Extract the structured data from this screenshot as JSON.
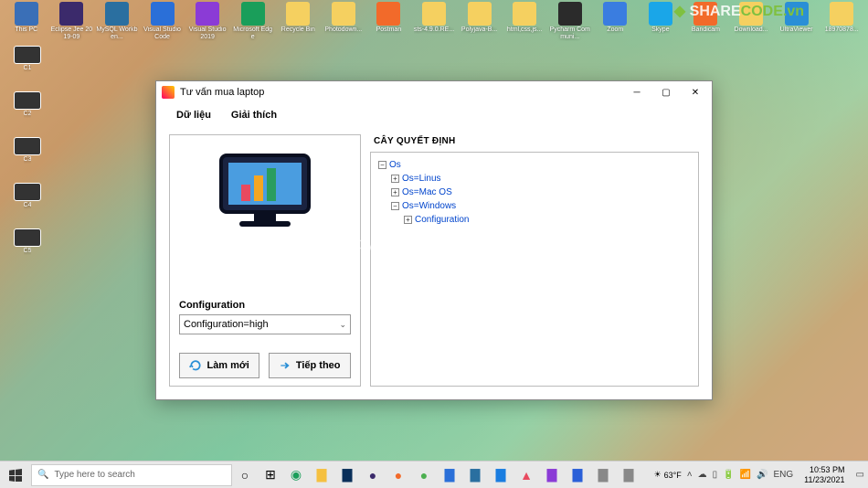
{
  "desktop": {
    "row1": [
      {
        "label": "This PC",
        "color": "#3a6fb7"
      },
      {
        "label": "Eclipse Jee 2019-09",
        "color": "#3b2a6b"
      },
      {
        "label": "MySQL Workben...",
        "color": "#2a6fa0"
      },
      {
        "label": "Visual Studio Code",
        "color": "#2a6fd8"
      },
      {
        "label": "Visual Studio 2019",
        "color": "#8b3bd6"
      },
      {
        "label": "Microsoft Edge",
        "color": "#1a9e5a"
      },
      {
        "label": "Recycle Bin",
        "color": "#f5d060"
      },
      {
        "label": "Photodown...",
        "color": "#f5d060"
      },
      {
        "label": "Postman",
        "color": "#f26a2a"
      },
      {
        "label": "sts-4.9.0.RE...",
        "color": "#f5d060"
      },
      {
        "label": "Polyjava-B...",
        "color": "#f5d060"
      },
      {
        "label": "html,css,js...",
        "color": "#f5d060"
      },
      {
        "label": "Pycharm Communi...",
        "color": "#2b2b2b"
      },
      {
        "label": "Zoom",
        "color": "#3a7de0"
      },
      {
        "label": "Skype",
        "color": "#1aa6e8"
      },
      {
        "label": "Bandicam",
        "color": "#f26a2a"
      },
      {
        "label": "Download...",
        "color": "#f5d060"
      },
      {
        "label": "UltraViewer",
        "color": "#2a8fd6"
      },
      {
        "label": "18970878...",
        "color": "#f5d060"
      }
    ],
    "col": [
      {
        "label": "C1",
        "color": "#333"
      },
      {
        "label": "C2",
        "color": "#333"
      },
      {
        "label": "C3",
        "color": "#333"
      },
      {
        "label": "C4",
        "color": "#333"
      },
      {
        "label": "C5",
        "color": "#333"
      }
    ]
  },
  "app": {
    "title": "Tư vấn mua laptop",
    "menu": {
      "data": "Dữ liệu",
      "explain": "Giải thích"
    },
    "left": {
      "cfg_label": "Configuration",
      "dropdown_value": "Configuration=high",
      "btn_refresh": "Làm mới",
      "btn_next": "Tiếp theo"
    },
    "right": {
      "header": "CÂY QUYẾT ĐỊNH",
      "tree": {
        "root": "Os",
        "children": [
          {
            "label": "Os=Linus"
          },
          {
            "label": "Os=Mac OS"
          },
          {
            "label": "Os=Windows",
            "children": [
              {
                "label": "Configuration"
              }
            ]
          }
        ]
      }
    }
  },
  "taskbar": {
    "search_placeholder": "Type here to search",
    "temp": "63°F",
    "lang": "ENG",
    "time": "10:53 PM",
    "date": "11/23/2021"
  },
  "watermark": {
    "center": "Copyright © ShareCode.vn",
    "logo_prefix": "SHARE",
    "logo_suffix": "CODE.vn"
  }
}
